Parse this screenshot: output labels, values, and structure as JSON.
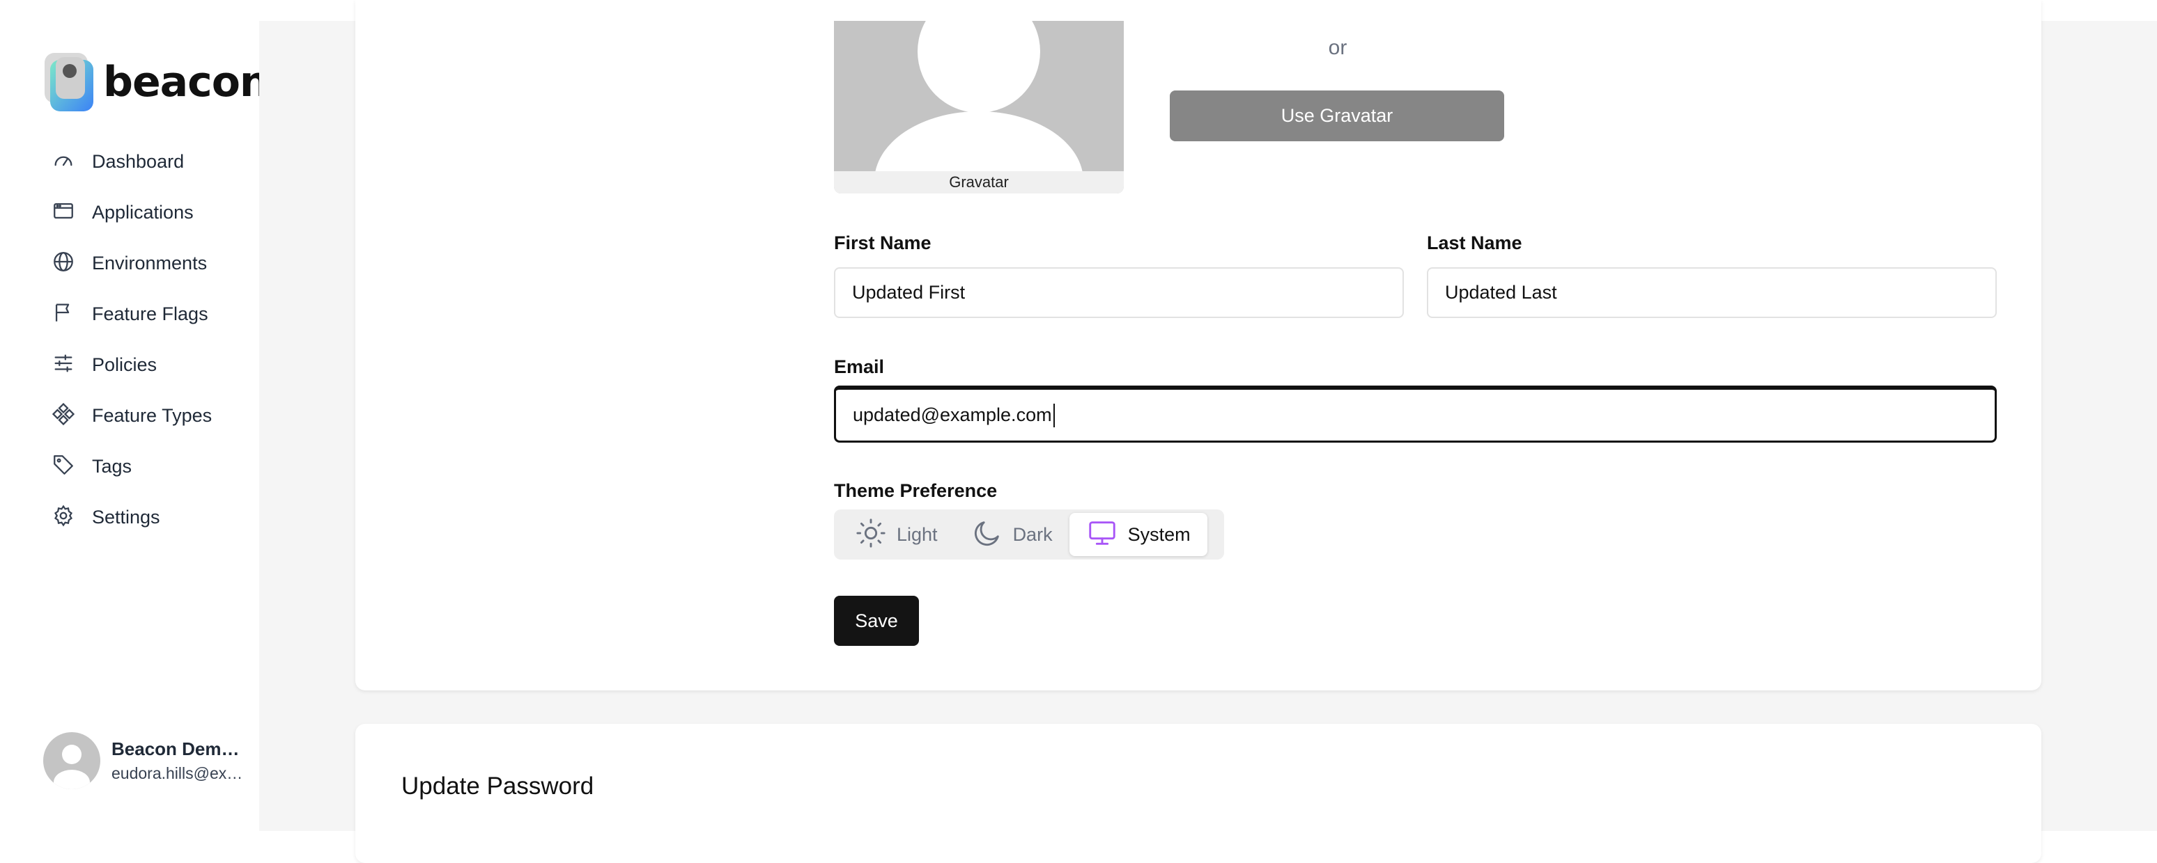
{
  "brand": {
    "name": "beacon"
  },
  "sidebar": {
    "items": [
      {
        "label": "Dashboard",
        "icon": "gauge-icon"
      },
      {
        "label": "Applications",
        "icon": "window-icon"
      },
      {
        "label": "Environments",
        "icon": "globe-icon"
      },
      {
        "label": "Feature Flags",
        "icon": "flag-icon"
      },
      {
        "label": "Policies",
        "icon": "sliders-icon"
      },
      {
        "label": "Feature Types",
        "icon": "shapes-icon"
      },
      {
        "label": "Tags",
        "icon": "tag-icon"
      },
      {
        "label": "Settings",
        "icon": "gear-icon"
      }
    ]
  },
  "user": {
    "name": "Beacon Demo…",
    "email": "eudora.hills@ex…"
  },
  "profile_form": {
    "gravatar_caption": "Gravatar",
    "or_text": "or",
    "use_gravatar_label": "Use Gravatar",
    "first_name_label": "First Name",
    "first_name_value": "Updated First",
    "last_name_label": "Last Name",
    "last_name_value": "Updated Last",
    "email_label": "Email",
    "email_value": "updated@example.com",
    "theme_label": "Theme Preference",
    "theme_options": [
      {
        "label": "Light",
        "icon": "sun-icon",
        "selected": false
      },
      {
        "label": "Dark",
        "icon": "moon-icon",
        "selected": false
      },
      {
        "label": "System",
        "icon": "monitor-icon",
        "selected": true
      }
    ],
    "save_label": "Save"
  },
  "password_section": {
    "title": "Update Password"
  },
  "colors": {
    "accent_system": "#a855f7",
    "save_button": "#141414",
    "gravatar_button": "#868686"
  }
}
